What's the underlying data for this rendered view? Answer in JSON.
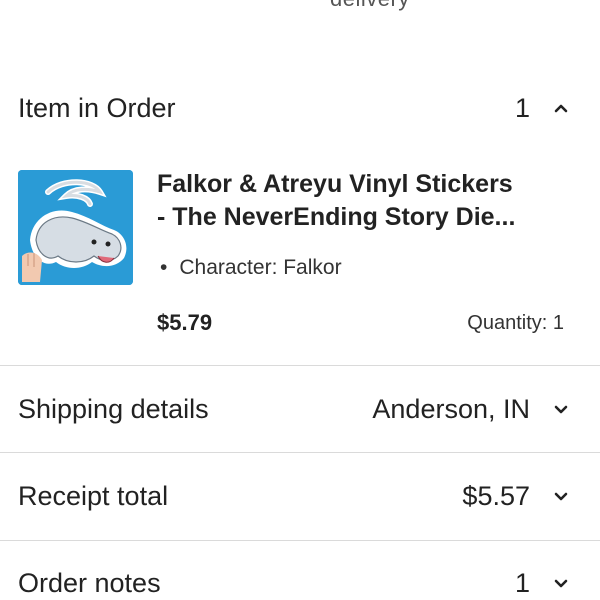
{
  "top_partial_text": "delivery",
  "item_in_order": {
    "label": "Item in Order",
    "count": "1",
    "chevron_icon": "chevron-up-icon"
  },
  "item": {
    "thumbnail_icon": "sticker-image",
    "title_line1": "Falkor & Atreyu Vinyl Stickers",
    "title_line2": "- The NeverEnding Story Die...",
    "variation": "Character: Falkor",
    "bullet": "•",
    "price": "$5.79",
    "quantity": "Quantity: 1"
  },
  "shipping": {
    "label": "Shipping details",
    "value": "Anderson, IN",
    "chevron_icon": "chevron-down-icon"
  },
  "receipt": {
    "label": "Receipt total",
    "value": "$5.57",
    "chevron_icon": "chevron-down-icon"
  },
  "order_notes": {
    "label": "Order notes",
    "value": "1",
    "chevron_icon": "chevron-down-icon"
  },
  "colors": {
    "text": "#222222",
    "divider": "#dadada",
    "thumb_bg": "#2a9bd6"
  }
}
